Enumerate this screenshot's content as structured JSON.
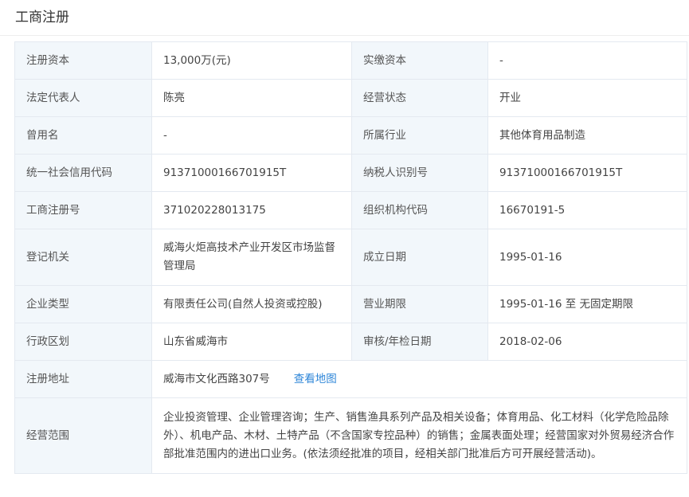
{
  "section_title": "工商注册",
  "rows": [
    {
      "l1": "注册资本",
      "v1": "13,000万(元)",
      "l2": "实缴资本",
      "v2": "-"
    },
    {
      "l1": "法定代表人",
      "v1": "陈亮",
      "l2": "经营状态",
      "v2": "开业"
    },
    {
      "l1": "曾用名",
      "v1": "-",
      "l2": "所属行业",
      "v2": "其他体育用品制造"
    },
    {
      "l1": "统一社会信用代码",
      "v1": "91371000166701915T",
      "l2": "纳税人识别号",
      "v2": "91371000166701915T"
    },
    {
      "l1": "工商注册号",
      "v1": "371020228013175",
      "l2": "组织机构代码",
      "v2": "16670191-5"
    },
    {
      "l1": "登记机关",
      "v1": "威海火炬高技术产业开发区市场监督管理局",
      "l2": "成立日期",
      "v2": "1995-01-16"
    },
    {
      "l1": "企业类型",
      "v1": "有限责任公司(自然人投资或控股)",
      "l2": "营业期限",
      "v2": "1995-01-16 至 无固定期限"
    },
    {
      "l1": "行政区划",
      "v1": "山东省威海市",
      "l2": "审核/年检日期",
      "v2": "2018-02-06"
    }
  ],
  "address": {
    "label": "注册地址",
    "value": "威海市文化西路307号",
    "map_link": "查看地图"
  },
  "scope": {
    "label": "经营范围",
    "value": "企业投资管理、企业管理咨询；生产、销售渔具系列产品及相关设备；体育用品、化工材料（化学危险品除外）、机电产品、木材、土特产品（不含国家专控品种）的销售；金属表面处理；经营国家对外贸易经济合作部批准范围内的进出口业务。(依法须经批准的项目，经相关部门批准后方可开展经营活动)。"
  },
  "colors": {
    "label_bg": "#f2f7fb",
    "border": "#e4e9f0",
    "link": "#2e86d8"
  }
}
